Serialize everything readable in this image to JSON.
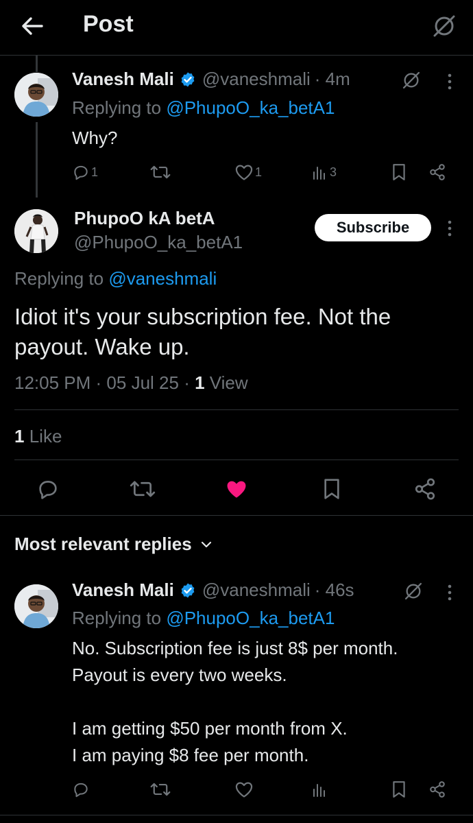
{
  "header": {
    "title": "Post",
    "back_icon": "arrow-left-icon",
    "right_icon": "grok-slash-icon"
  },
  "parent_reply": {
    "name": "Vanesh Mali",
    "handle": "@vaneshmali",
    "time": "· 4m",
    "replying_prefix": "Replying to",
    "replying_to": "@PhupoO_ka_betA1",
    "text": "Why?",
    "actions": {
      "reply_count": "1",
      "like_count": "1",
      "views_count": "3"
    }
  },
  "main_post": {
    "name": "PhupoO kA betA",
    "handle": "@PhupoO_ka_betA1",
    "subscribe_label": "Subscribe",
    "replying_prefix": "Replying to",
    "replying_to": "@vaneshmali",
    "text": "Idiot it's your subscription fee. Not the payout. Wake up.",
    "time": "12:05 PM",
    "date": "05 Jul 25",
    "views_count": "1",
    "views_label": "View",
    "likes_count": "1",
    "likes_label": "Like",
    "liked": true
  },
  "replies_section": {
    "sort_label": "Most relevant replies"
  },
  "reply": {
    "name": "Vanesh Mali",
    "handle": "@vaneshmali",
    "time": "· 46s",
    "replying_prefix": "Replying to",
    "replying_to": "@PhupoO_ka_betA1",
    "text_line1": "No. Subscription fee is just 8$ per month.",
    "text_line2": "Payout is every two weeks.",
    "text_line3": "I am getting $50 per month from X.",
    "text_line4": "I am paying $8 fee per month."
  },
  "colors": {
    "accent": "#1d9bf0",
    "like_pink": "#f91880",
    "muted": "#71767b",
    "divider": "#2f3336"
  }
}
